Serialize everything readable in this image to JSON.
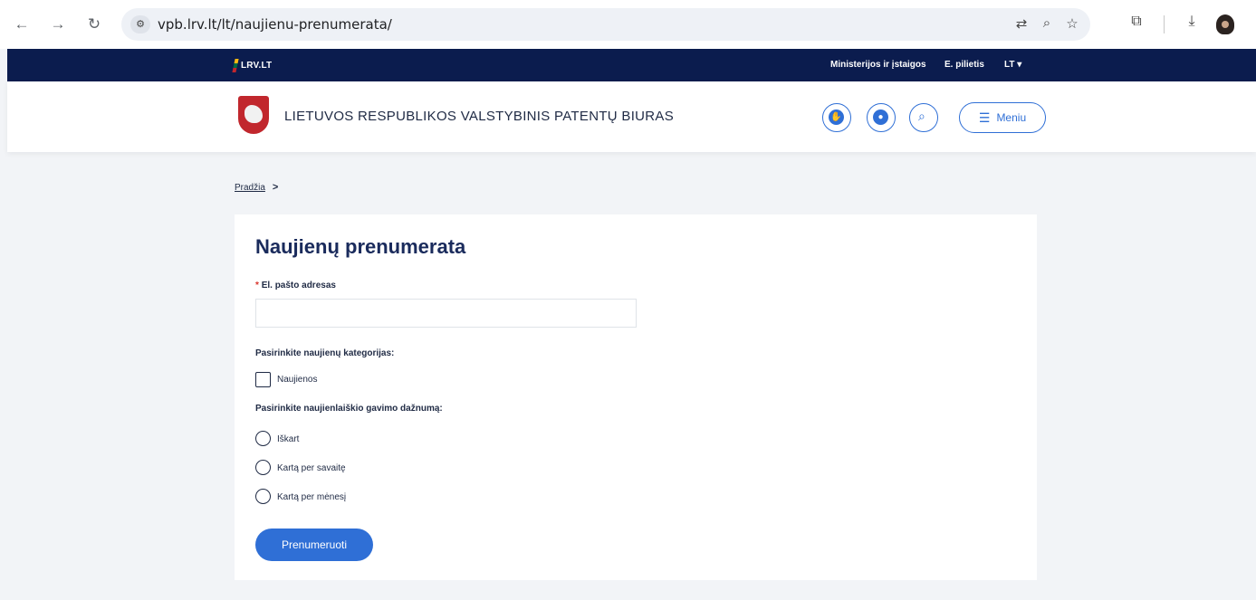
{
  "browser": {
    "url": "vpb.lrv.lt/lt/naujienu-prenumerata/",
    "back_icon": "arrow-left-icon",
    "forward_icon": "arrow-right-icon",
    "reload_icon": "reload-icon",
    "site_info_icon": "tune-icon",
    "translate_icon": "translate-icon",
    "zoom_icon": "zoom-icon",
    "bookmark_icon": "star-icon",
    "extensions_icon": "puzzle-icon",
    "downloads_icon": "download-icon",
    "profile_icon": "avatar"
  },
  "govbar": {
    "logo_text": "LRV.LT",
    "links": {
      "institutions": "Ministerijos ir įstaigos",
      "citizen": "E. pilietis",
      "language": "LT ▾"
    },
    "color": "#0b1c4e"
  },
  "header": {
    "site_title": "LIETUVOS RESPUBLIKOS VALSTYBINIS PATENTŲ BIURAS",
    "menu_label": "Meniu",
    "accent_color": "#2f6fd6"
  },
  "breadcrumb": {
    "home": "Pradžia",
    "separator": ">"
  },
  "form": {
    "title": "Naujienų prenumerata",
    "email_required_mark": "*",
    "email_label": "El. pašto adresas",
    "email_value": "",
    "categories_label": "Pasirinkite naujienų kategorijas:",
    "categories": [
      {
        "label": "Naujienos",
        "checked": false
      }
    ],
    "frequency_label": "Pasirinkite naujienlaiškio gavimo dažnumą:",
    "frequencies": [
      {
        "label": "Iškart",
        "selected": false
      },
      {
        "label": "Kartą per savaitę",
        "selected": false
      },
      {
        "label": "Kartą per mėnesį",
        "selected": false
      }
    ],
    "submit_label": "Prenumeruoti"
  }
}
